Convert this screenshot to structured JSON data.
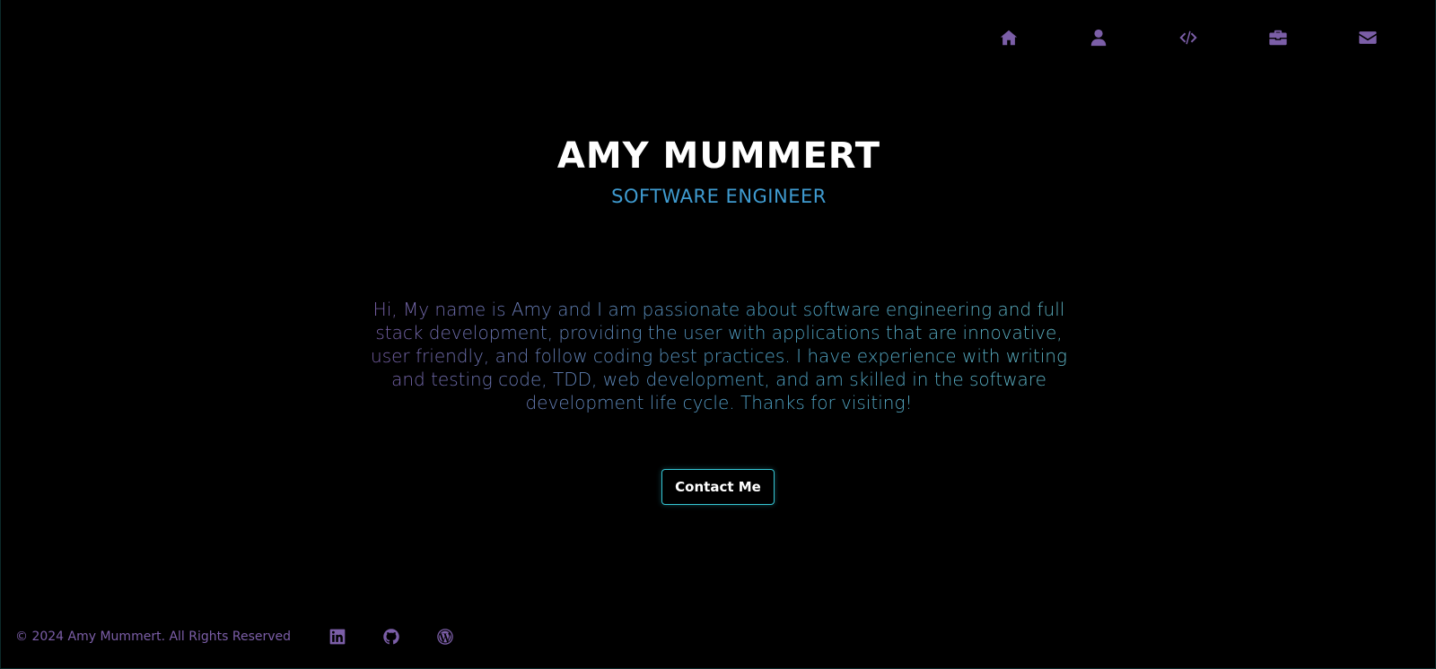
{
  "nav": {
    "items": [
      {
        "icon": "home-icon",
        "name": "nav-home"
      },
      {
        "icon": "user-icon",
        "name": "nav-about"
      },
      {
        "icon": "code-icon",
        "name": "nav-projects"
      },
      {
        "icon": "briefcase-icon",
        "name": "nav-experience"
      },
      {
        "icon": "envelope-icon",
        "name": "nav-contact"
      }
    ]
  },
  "hero": {
    "name": "AMY MUMMERT",
    "title": "SOFTWARE ENGINEER",
    "intro": "Hi, My name is Amy and I am passionate about software engineering and full stack development, providing the user with applications that are innovative, user friendly, and follow coding best practices. I have experience with writing and testing code, TDD, web development, and am skilled in the software development life cycle. Thanks for visiting!",
    "contact_button": "Contact Me"
  },
  "footer": {
    "copyright": "© 2024 Amy Mummert. All Rights Reserved",
    "social": [
      {
        "icon": "linkedin-icon"
      },
      {
        "icon": "github-icon"
      },
      {
        "icon": "wordpress-icon"
      }
    ]
  },
  "colors": {
    "background": "#000000",
    "accent_purple": "#7b5ea7",
    "accent_blue": "#3f9bd0",
    "accent_cyan": "#35c6d4",
    "text_white": "#ffffff"
  }
}
